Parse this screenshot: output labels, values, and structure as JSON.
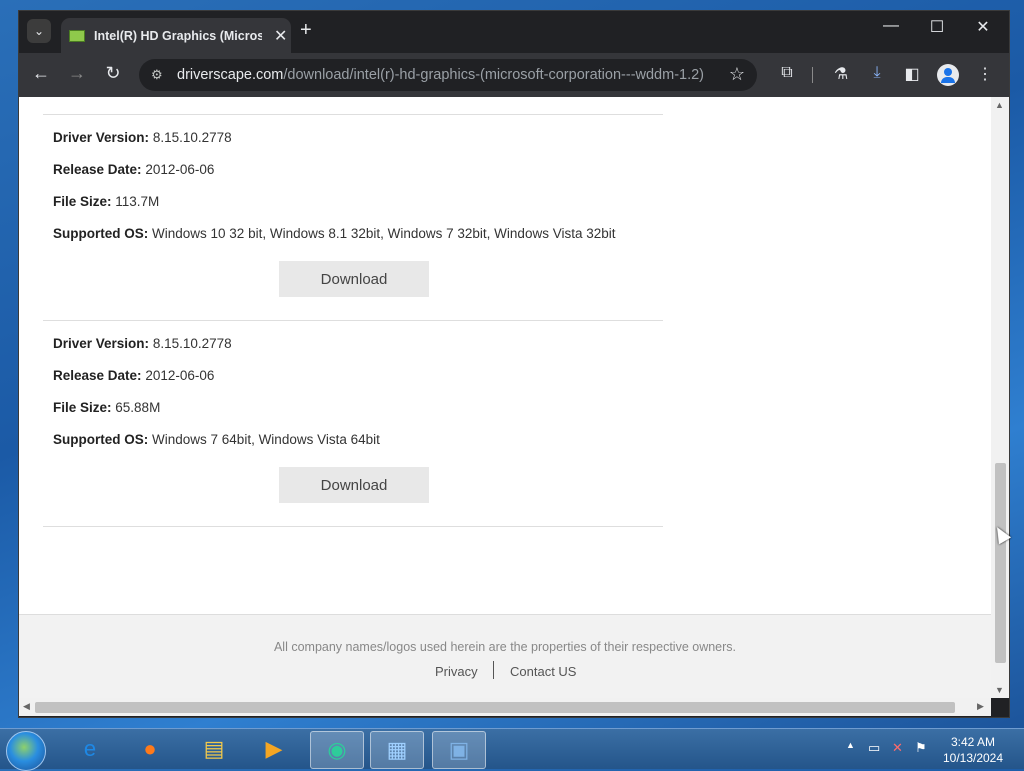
{
  "browser": {
    "tab_title": "Intel(R) HD Graphics (Microsof",
    "url_host": "driverscape.com",
    "url_path": "/download/intel(r)-hd-graphics-(microsoft-corporation---wddm-1.2)"
  },
  "icons": {
    "tab_search": "⌄",
    "tab_close": "✕",
    "new_tab": "+",
    "minimize": "—",
    "maximize": "☐",
    "close_window": "✕",
    "back": "←",
    "forward": "→",
    "reload": "↻",
    "site_info": "⚙",
    "star": "☆",
    "extensions": "⧉",
    "labs": "⚗",
    "download": "⤓",
    "sidepanel": "◧",
    "menu": "⋮"
  },
  "labels": {
    "driver_version": "Driver Version:",
    "release_date": "Release Date:",
    "file_size": "File Size:",
    "supported_os": "Supported OS:"
  },
  "drivers": [
    {
      "driver_version": "8.15.10.2778",
      "release_date": "2012-06-06",
      "file_size": "113.7M",
      "supported_os": "Windows 10 32 bit, Windows 8.1 32bit, Windows 7 32bit, Windows Vista 32bit",
      "download_label": "Download"
    },
    {
      "driver_version": "8.15.10.2778",
      "release_date": "2012-06-06",
      "file_size": "65.88M",
      "supported_os": "Windows 7 64bit, Windows Vista 64bit",
      "download_label": "Download"
    }
  ],
  "footer": {
    "note": "All company names/logos used herein are the properties of their respective owners.",
    "privacy": "Privacy",
    "contact": "Contact US"
  },
  "taskbar": {
    "time": "3:42 AM",
    "date": "10/13/2024"
  },
  "colors": {
    "chrome_dark": "#202124",
    "toolbar": "#35363a",
    "download_button_bg": "#e8e8e8",
    "footer_bg": "#f2f2f2"
  }
}
